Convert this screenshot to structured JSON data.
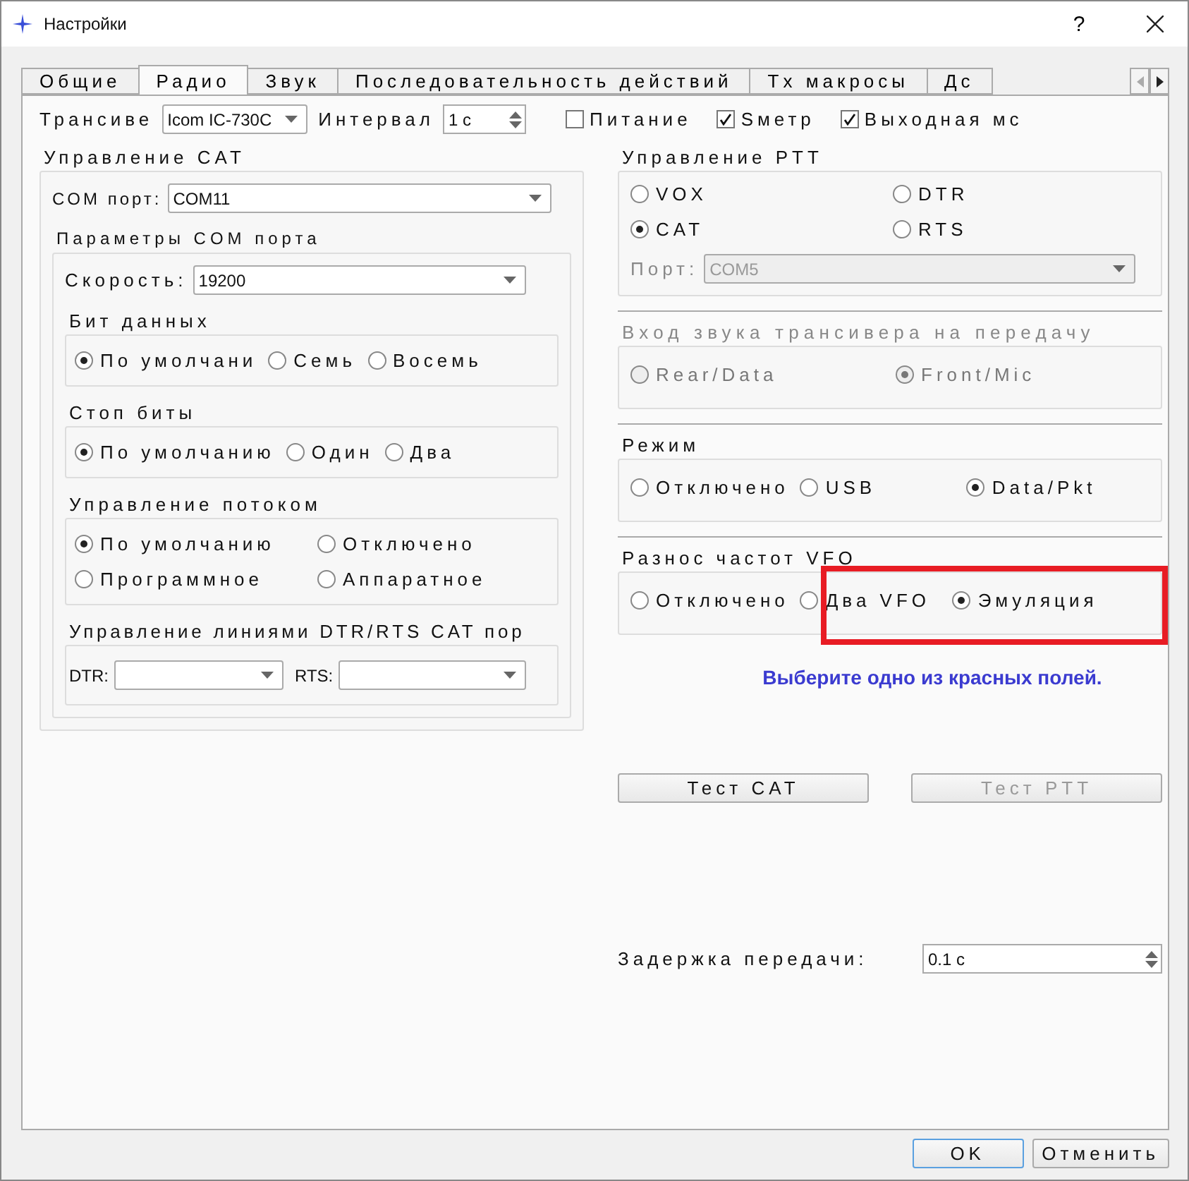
{
  "window": {
    "title": "Настройки",
    "help": "?"
  },
  "tabs": [
    {
      "label": "Общие",
      "selected": false
    },
    {
      "label": "Радио",
      "selected": true
    },
    {
      "label": "Звук",
      "selected": false
    },
    {
      "label": "Последовательность действий",
      "selected": false
    },
    {
      "label": "Tx макросы",
      "selected": false
    },
    {
      "label": "Дс",
      "selected": false
    }
  ],
  "top_row": {
    "transceiver_label": "Трансиве",
    "transceiver": "Icom IC-730C",
    "interval_label": "Интервал",
    "interval": "1 с",
    "checks": [
      {
        "label": "Питание",
        "checked": false
      },
      {
        "label": "Sметр",
        "checked": true
      },
      {
        "label": "Выходная мс",
        "checked": true
      }
    ]
  },
  "cat": {
    "title": "Управление CAT",
    "com_port_label": "COM порт:",
    "com_port": "COM11",
    "params_title": "Параметры COM порта",
    "speed_label": "Скорость:",
    "speed": "19200",
    "groups": [
      {
        "title": "Бит данных",
        "rows": [
          [
            {
              "label": "По умолчани",
              "selected": true
            },
            {
              "label": "Семь",
              "selected": false
            },
            {
              "label": "Восемь",
              "selected": false
            }
          ]
        ]
      },
      {
        "title": "Стоп биты",
        "rows": [
          [
            {
              "label": "По умолчанию",
              "selected": true
            },
            {
              "label": "Один",
              "selected": false
            },
            {
              "label": "Два",
              "selected": false
            }
          ]
        ]
      },
      {
        "title": "Управление потоком",
        "rows": [
          [
            {
              "label": "По умолчанию",
              "selected": true
            },
            {
              "label": "Отключено",
              "selected": false
            }
          ],
          [
            {
              "label": "Программное",
              "selected": false
            },
            {
              "label": "Аппаратное",
              "selected": false
            }
          ]
        ]
      }
    ],
    "lines": {
      "title": "Управление линиями DTR/RTS CAT пор",
      "dtr_label": "DTR:",
      "rts_label": "RTS:"
    }
  },
  "ptt": {
    "title": "Управление PTT",
    "rows": [
      [
        {
          "label": "VOX",
          "selected": false
        },
        {
          "label": "DTR",
          "selected": false
        }
      ],
      [
        {
          "label": "CAT",
          "selected": true
        },
        {
          "label": "RTS",
          "selected": false
        }
      ]
    ],
    "port_label": "Порт:",
    "port": "COM5",
    "port_disabled": true
  },
  "right_groups": [
    {
      "title": "Вход звука трансивера на передачу",
      "disabled": true,
      "highlighted": false,
      "options": [
        {
          "label": "Rear/Data",
          "selected": false
        },
        {
          "label": "Front/Mic",
          "selected": true
        }
      ]
    },
    {
      "title": "Режим",
      "disabled": false,
      "highlighted": false,
      "options": [
        {
          "label": "Отключено",
          "selected": false
        },
        {
          "label": "USB",
          "selected": false
        },
        {
          "label": "Data/Pkt",
          "selected": true
        }
      ]
    },
    {
      "title": "Разнос частот VFO",
      "disabled": false,
      "highlighted": true,
      "options": [
        {
          "label": "Отключено",
          "selected": false
        },
        {
          "label": "Два VFO",
          "selected": false
        },
        {
          "label": "Эмуляция",
          "selected": true
        }
      ]
    }
  ],
  "message": "Выберите одно из красных полей.",
  "test_buttons": [
    {
      "label": "Тест CAT",
      "disabled": false
    },
    {
      "label": "Тест PTT",
      "disabled": true
    }
  ],
  "delay": {
    "label": "Задержка передачи:",
    "value": "0.1 с"
  },
  "footer_buttons": [
    {
      "label": "OK",
      "default": true
    },
    {
      "label": "Отменить",
      "default": false
    }
  ]
}
